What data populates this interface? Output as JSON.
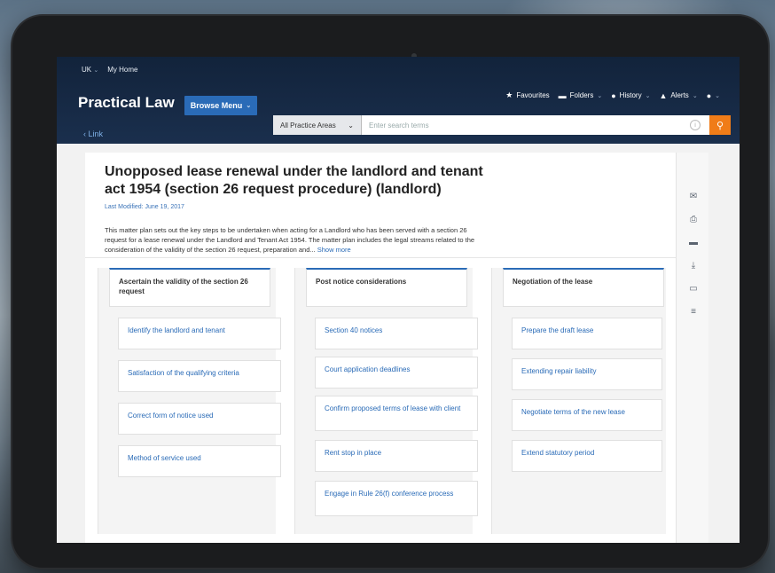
{
  "header": {
    "region": "UK",
    "my_home": "My Home",
    "brand": "Practical Law",
    "browse_menu": "Browse Menu",
    "nav": {
      "favourites": "Favourites",
      "folders": "Folders",
      "history": "History",
      "alerts": "Alerts"
    },
    "practice_area": "All Practice Areas",
    "search_placeholder": "Enter search terms"
  },
  "breadcrumb": {
    "back_link": "Link"
  },
  "document": {
    "title": "Unopposed lease renewal under the landlord and tenant act 1954 (section 26 request procedure) (landlord)",
    "last_modified": "Last Modified: June 19, 2017",
    "summary": "This matter plan sets out the key steps to be undertaken when acting for a Landlord who has been served with a section 26 request for a lease renewal under the Landlord and Tenant Act 1954.  The matter plan includes the legal streams related to the consideration of the validity of the section 26 request, preparation and...",
    "show_more": "Show more"
  },
  "lanes": [
    {
      "heading": "Ascertain the validity of the section 26 request",
      "cards": [
        "Identify the landlord and tenant",
        "Satisfaction of the qualifying criteria",
        "Correct form of notice used",
        "Method of service used"
      ]
    },
    {
      "heading": "Post notice considerations",
      "cards": [
        "Section 40 notices",
        "Court application deadlines",
        "Confirm proposed terms of lease with client",
        "Rent stop in place",
        "Engage in Rule 26(f) conference process"
      ]
    },
    {
      "heading": "Negotiation of the lease",
      "cards": [
        "Prepare the draft lease",
        "Extending repair liability",
        "Negotiate terms of the new lease",
        "Extend statutory period"
      ]
    }
  ],
  "sidebar_icons": [
    "email-icon",
    "print-icon",
    "folder-icon",
    "download-icon",
    "annotate-icon",
    "document-icon"
  ],
  "colors": {
    "header_bg": "#1a2f4d",
    "accent": "#2a6bb7",
    "search_button": "#f07c18"
  }
}
